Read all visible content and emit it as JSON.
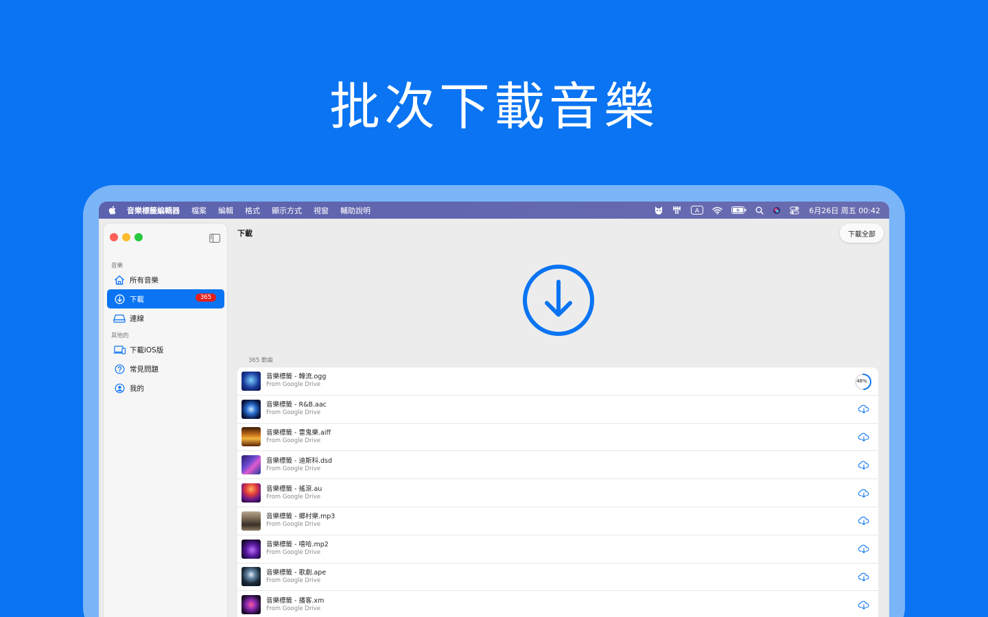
{
  "hero": {
    "title": "批次下載音樂"
  },
  "menubar": {
    "app_name": "音樂標籤編輯器",
    "items": [
      "檔案",
      "編輯",
      "格式",
      "顯示方式",
      "視窗",
      "輔助說明"
    ],
    "status_icons": [
      "cat-icon",
      "tuning-fork-icon",
      "input-source-icon",
      "wifi-icon",
      "battery-icon",
      "search-icon",
      "siri-icon",
      "control-center-icon"
    ],
    "input_source_label": "A",
    "clock": "6月26日 周五 00:42"
  },
  "sidebar": {
    "section_music": "音樂",
    "section_other": "其他的",
    "items": [
      {
        "label": "所有音樂",
        "icon": "home-icon"
      },
      {
        "label": "下載",
        "icon": "download-circle-icon",
        "badge": "365",
        "active": true
      },
      {
        "label": "連線",
        "icon": "drive-icon"
      },
      {
        "label": "下載iOS版",
        "icon": "devices-icon"
      },
      {
        "label": "常見問題",
        "icon": "question-icon"
      },
      {
        "label": "我的",
        "icon": "person-icon"
      }
    ]
  },
  "main": {
    "title": "下載",
    "download_all": "下載全部",
    "count_label": "365 歌曲",
    "accent_color": "#0a74f2",
    "songs": [
      {
        "title": "音樂標籤 - 韓流.ogg",
        "source": "From Google Drive",
        "progress": "48%",
        "progress_value": 0.48
      },
      {
        "title": "音樂標籤 - R&B.aac",
        "source": "From Google Drive"
      },
      {
        "title": "音樂標籤 - 雷鬼樂.aiff",
        "source": "From Google Drive"
      },
      {
        "title": "音樂標籤 - 迪斯科.dsd",
        "source": "From Google Drive"
      },
      {
        "title": "音樂標籤 - 搖滾.au",
        "source": "From Google Drive"
      },
      {
        "title": "音樂標籤 - 鄉村樂.mp3",
        "source": "From Google Drive"
      },
      {
        "title": "音樂標籤 - 嘻哈.mp2",
        "source": "From Google Drive"
      },
      {
        "title": "音樂標籤 - 歌劇.ape",
        "source": "From Google Drive"
      },
      {
        "title": "音樂標籤 - 播客.xm",
        "source": "From Google Drive"
      }
    ]
  }
}
